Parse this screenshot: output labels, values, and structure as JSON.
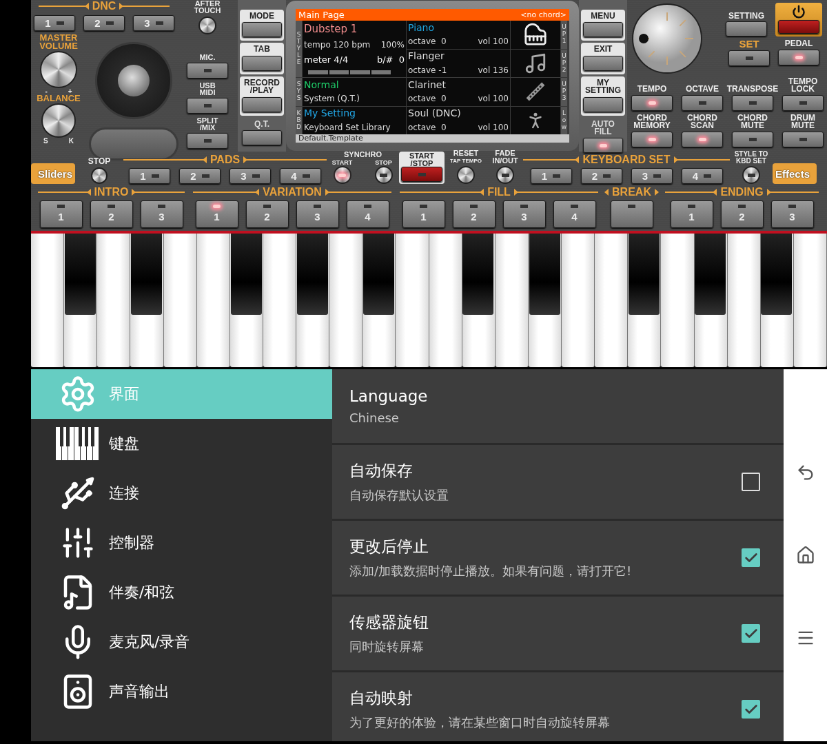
{
  "dnc": {
    "title": "DNC",
    "buttons": [
      {
        "label": "1",
        "lit": false
      },
      {
        "label": "2",
        "lit": false
      },
      {
        "label": "3",
        "lit": false
      }
    ]
  },
  "after_touch": {
    "label": "AFTER\nTOUCH"
  },
  "master_volume": {
    "label": "MASTER\nVOLUME",
    "min": "-",
    "max": "+"
  },
  "balance": {
    "label": "BALANCE",
    "min": "S",
    "max": "K"
  },
  "input_buttons": [
    {
      "label": "MIC.",
      "lit": false
    },
    {
      "label": "USB\nMIDI",
      "lit": false
    },
    {
      "label": "SPLIT\n/MIX",
      "lit": false
    }
  ],
  "mode_buttons": [
    {
      "label": "MODE",
      "kind": "card"
    },
    {
      "label": "TAB",
      "kind": "card"
    },
    {
      "label": "RECORD\n/PLAY",
      "kind": "card"
    },
    {
      "label": "Q.T.",
      "kind": "plain"
    }
  ],
  "display": {
    "title": "Main Page",
    "chord": "<no chord>",
    "style_label": "STYLE",
    "style": {
      "name": "Dubstep 1",
      "tempo": "tempo 120 bpm",
      "tempo_percent": "100%",
      "meter": "meter 4/4",
      "key": "b/#  0"
    },
    "sys_label": "SYS",
    "sys": {
      "name": "Normal",
      "detail": "System (Q.T.)"
    },
    "kbd_label": "KBD",
    "kbd": {
      "name": "My Setting",
      "detail": "Keyboard Set Library"
    },
    "parts": [
      {
        "name": "Piano",
        "octave": "octave  0",
        "vol": "vol 100",
        "slot": "UP1",
        "selected": true
      },
      {
        "name": "Flanger",
        "octave": "octave -1",
        "vol": "vol 136",
        "slot": "UP2",
        "selected": false
      },
      {
        "name": "Clarinet",
        "octave": "octave  0",
        "vol": "vol 100",
        "slot": "UP3",
        "selected": false
      },
      {
        "name": "Soul (DNC)",
        "octave": "octave  0",
        "vol": "vol 100",
        "slot": "Low",
        "selected": false
      }
    ],
    "footer": "Default.Template"
  },
  "menu_buttons": [
    {
      "label": "MENU",
      "kind": "card"
    },
    {
      "label": "EXIT",
      "kind": "card"
    },
    {
      "label": "MY\nSETTING",
      "kind": "card"
    },
    {
      "label": "AUTO\nFILL",
      "kind": "plain",
      "lit": true
    }
  ],
  "setting": {
    "label": "SETTING"
  },
  "set": {
    "label": "SET",
    "lit": false
  },
  "pedal": {
    "label": "PEDAL",
    "lit": true
  },
  "function_rows": [
    [
      {
        "label": "TEMPO",
        "lit": true
      },
      {
        "label": "OCTAVE",
        "lit": false
      },
      {
        "label": "TRANSPOSE",
        "lit": false
      },
      {
        "label": "TEMPO\nLOCK",
        "lit": false
      }
    ],
    [
      {
        "label": "CHORD\nMEMORY",
        "lit": true
      },
      {
        "label": "CHORD\nSCAN",
        "lit": true
      },
      {
        "label": "CHORD\nMUTE",
        "lit": false
      },
      {
        "label": "DRUM\nMUTE",
        "lit": false
      }
    ]
  ],
  "pads_row": {
    "sliders": "Sliders",
    "stop": "STOP",
    "pads": {
      "title": "PADS",
      "buttons": [
        {
          "label": "1",
          "lit": false
        },
        {
          "label": "2",
          "lit": false
        },
        {
          "label": "3",
          "lit": false
        },
        {
          "label": "4",
          "lit": false
        }
      ]
    },
    "synchro": {
      "title": "SYNCHRO",
      "start": {
        "label": "START",
        "lit": true
      },
      "stop": {
        "label": "STOP",
        "lit": false
      }
    },
    "start_stop": {
      "label": "START\n/STOP",
      "lit": false
    },
    "reset": "RESET",
    "tap_tempo": "TAP TEMPO",
    "fade": {
      "label": "FADE\nIN/OUT",
      "lit": false
    },
    "keyboard_set": {
      "title": "KEYBOARD SET",
      "buttons": [
        {
          "label": "1",
          "lit": false
        },
        {
          "label": "2",
          "lit": false
        },
        {
          "label": "3",
          "lit": false
        },
        {
          "label": "4",
          "lit": false
        }
      ]
    },
    "style_to_kbd": {
      "label": "STYLE TO\nKBD SET",
      "lit": false
    },
    "effects": "Effects"
  },
  "sections": [
    {
      "title": "INTRO",
      "buttons": [
        {
          "label": "1",
          "lit": false
        },
        {
          "label": "2",
          "lit": false
        },
        {
          "label": "3",
          "lit": false
        }
      ]
    },
    {
      "title": "VARIATION",
      "buttons": [
        {
          "label": "1",
          "lit": true
        },
        {
          "label": "2",
          "lit": false
        },
        {
          "label": "3",
          "lit": false
        },
        {
          "label": "4",
          "lit": false
        }
      ]
    },
    {
      "title": "FILL",
      "buttons": [
        {
          "label": "1",
          "lit": false
        },
        {
          "label": "2",
          "lit": false
        },
        {
          "label": "3",
          "lit": false
        },
        {
          "label": "4",
          "lit": false
        }
      ]
    },
    {
      "title": "BREAK",
      "buttons": [
        {
          "lit": false
        }
      ]
    },
    {
      "title": "ENDING",
      "buttons": [
        {
          "label": "1",
          "lit": false
        },
        {
          "label": "2",
          "lit": false
        },
        {
          "label": "3",
          "lit": false
        }
      ]
    }
  ],
  "sidebar": [
    {
      "label": "界面",
      "selected": true
    },
    {
      "label": "键盘",
      "selected": false
    },
    {
      "label": "连接",
      "selected": false
    },
    {
      "label": "控制器",
      "selected": false
    },
    {
      "label": "伴奏/和弦",
      "selected": false
    },
    {
      "label": "麦克风/录音",
      "selected": false
    },
    {
      "label": "声音输出",
      "selected": false
    }
  ],
  "settings": [
    {
      "kind": "value",
      "title": "Language",
      "value": "Chinese"
    },
    {
      "kind": "checkbox",
      "title": "自动保存",
      "subtitle": "自动保存默认设置",
      "checked": false
    },
    {
      "kind": "checkbox",
      "title": "更改后停止",
      "subtitle": "添加/加载数据时停止播放。如果有问题，请打开它!",
      "checked": true
    },
    {
      "kind": "checkbox",
      "title": "传感器旋钮",
      "subtitle": "同时旋转屏幕",
      "checked": true
    },
    {
      "kind": "checkbox",
      "title": "自动映射",
      "subtitle": "为了更好的体验，请在某些窗口时自动旋转屏幕",
      "checked": true
    }
  ]
}
